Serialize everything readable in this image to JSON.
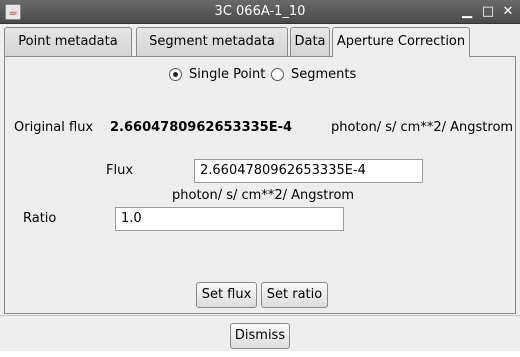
{
  "window": {
    "title": "3C 066A-1_10",
    "icons": {
      "app": "java-icon",
      "minimize": "minimize-icon",
      "maximize": "maximize-icon",
      "close": "close-icon"
    }
  },
  "tabs": [
    {
      "label": "Point metadata",
      "active": false
    },
    {
      "label": "Segment metadata",
      "active": false
    },
    {
      "label": "Data",
      "active": false
    },
    {
      "label": "Aperture Correction",
      "active": true
    }
  ],
  "mode": {
    "options": [
      {
        "label": "Single Point",
        "selected": true
      },
      {
        "label": "Segments",
        "selected": false
      }
    ]
  },
  "original_flux": {
    "label": "Original flux",
    "value": "2.6604780962653335E-4",
    "unit": "photon/ s/ cm**2/ Angstrom"
  },
  "flux": {
    "label": "Flux",
    "value": "2.6604780962653335E-4",
    "unit": "photon/ s/ cm**2/ Angstrom"
  },
  "ratio": {
    "label": "Ratio",
    "value": "1.0"
  },
  "buttons": {
    "set_flux": "Set flux",
    "set_ratio": "Set ratio",
    "dismiss": "Dismiss"
  }
}
